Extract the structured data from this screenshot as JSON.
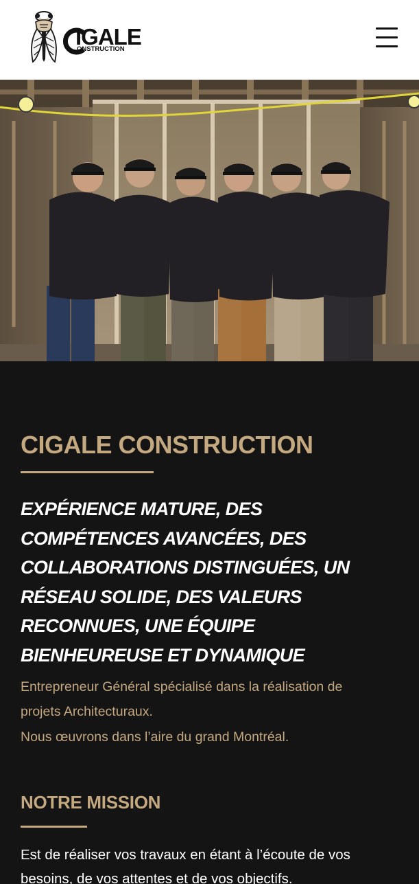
{
  "header": {
    "logo": {
      "word_main": "IGALE",
      "word_sub": "ONSTRUCTION",
      "emblem_icon": "cicada-icon"
    },
    "menu_icon": "hamburger-menu-icon"
  },
  "hero": {
    "image_description_icon": "team-photo"
  },
  "intro": {
    "title": "CIGALE CONSTRUCTION",
    "tagline": "EXPÉRIENCE MATURE, DES COMPÉTENCES AVANCÉES, DES COLLABORATIONS DISTINGUÉES, UN RÉSEAU SOLIDE, DES VALEURS RECONNUES, UNE ÉQUIPE BIENHEUREUSE ET DYNAMIQUE",
    "description_line_1": "Entrepreneur Général spécialisé dans la réalisation de",
    "description_line_2": "projets Architecturaux.",
    "description_line_3": "Nous œuvrons dans l’aire du grand Montréal."
  },
  "mission": {
    "title": "NOTRE MISSION",
    "text": "Est de réaliser vos travaux en étant à l’écoute de vos besoins, de vos attentes et de vos objectifs."
  },
  "colors": {
    "accent": "#c4a880",
    "background_dark": "#141414",
    "header_bg": "#ffffff"
  }
}
